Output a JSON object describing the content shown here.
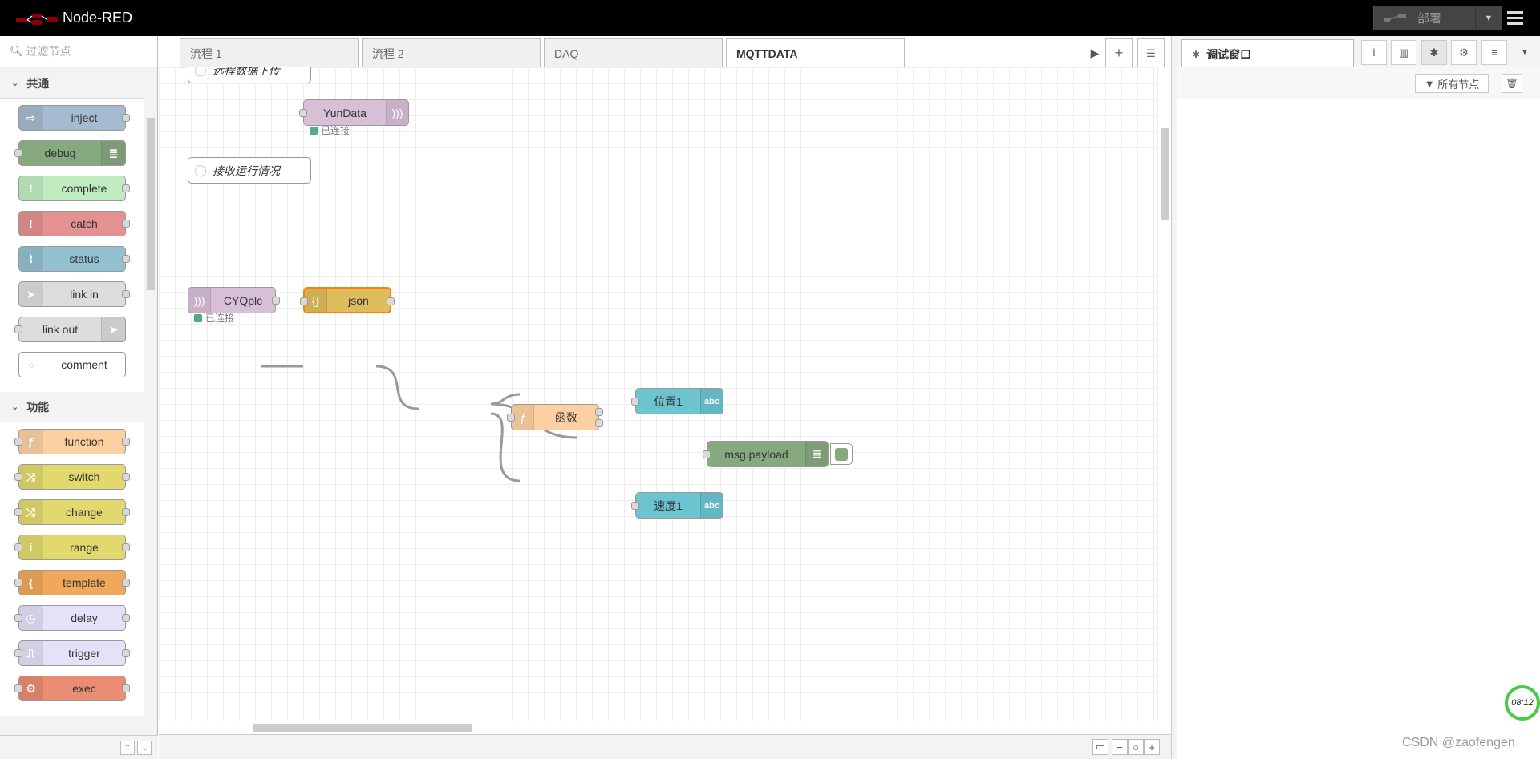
{
  "header": {
    "app_title": "Node-RED",
    "deploy_label": "部署"
  },
  "palette": {
    "search_placeholder": "过滤节点",
    "categories": [
      {
        "name": "共通",
        "nodes": [
          {
            "label": "inject",
            "color": "#a6bbcf",
            "icon": "arrow-icon"
          },
          {
            "label": "debug",
            "color": "#87a980",
            "icon": "list-icon"
          },
          {
            "label": "complete",
            "color": "#c0edc0",
            "icon": "exclamation-icon"
          },
          {
            "label": "catch",
            "color": "#e49191",
            "icon": "exclamation-icon"
          },
          {
            "label": "status",
            "color": "#94c1d0",
            "icon": "pulse-icon"
          },
          {
            "label": "link in",
            "color": "#dddddd",
            "icon": "link-arrow-icon"
          },
          {
            "label": "link out",
            "color": "#dddddd",
            "icon": "link-arrow-icon"
          },
          {
            "label": "comment",
            "color": "#ffffff",
            "icon": "comment-icon"
          }
        ]
      },
      {
        "name": "功能",
        "nodes": [
          {
            "label": "function",
            "color": "#fdd0a2",
            "icon": "function-icon"
          },
          {
            "label": "switch",
            "color": "#e2d96e",
            "icon": "switch-icon"
          },
          {
            "label": "change",
            "color": "#e2d96e",
            "icon": "shuffle-icon"
          },
          {
            "label": "range",
            "color": "#e2d96e",
            "icon": "range-icon"
          },
          {
            "label": "template",
            "color": "#f0a95a",
            "icon": "brace-icon"
          },
          {
            "label": "delay",
            "color": "#e6e0f8",
            "icon": "timer-icon"
          },
          {
            "label": "trigger",
            "color": "#e6e0f8",
            "icon": "trigger-icon"
          },
          {
            "label": "exec",
            "color": "#ea8d72",
            "icon": "gear-icon"
          }
        ]
      }
    ]
  },
  "tabs": [
    "流程 1",
    "流程 2",
    "DAQ",
    "MQTTDATA"
  ],
  "flow": {
    "comments": [
      "远程数据下传",
      "接收运行情况"
    ],
    "nodes": {
      "yundata": {
        "label": "YunData",
        "status": "已连接"
      },
      "cyqplc": {
        "label": "CYQplc",
        "status": "已连接"
      },
      "json": {
        "label": "json"
      },
      "func": {
        "label": "函数"
      },
      "pos": {
        "label": "位置1"
      },
      "speed": {
        "label": "速度1"
      },
      "payload": {
        "label": "msg.payload"
      }
    }
  },
  "sidebar": {
    "tab_label": "调试窗口",
    "filter_label": "所有节点"
  },
  "clock": "08:12",
  "watermark": "CSDN @zaofengen"
}
